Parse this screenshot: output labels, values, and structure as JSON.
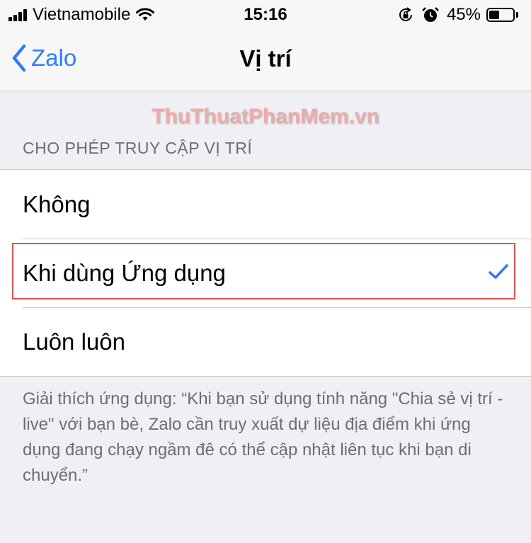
{
  "status_bar": {
    "carrier": "Vietnamobile",
    "time": "15:16",
    "battery_percent": "45%",
    "battery_level": 0.45,
    "icons": [
      "signal-icon",
      "wifi-icon",
      "rotation-lock-icon",
      "alarm-icon",
      "battery-icon"
    ]
  },
  "nav": {
    "back_label": "Zalo",
    "title": "Vị trí"
  },
  "watermark": "ThuThuatPhanMem.vn",
  "section": {
    "header": "CHO PHÉP TRUY CẬP VỊ TRÍ",
    "options": [
      {
        "label": "Không",
        "selected": false
      },
      {
        "label": "Khi dùng Ứng dụng",
        "selected": true
      },
      {
        "label": "Luôn luôn",
        "selected": false
      }
    ],
    "footer": "Giải thích ứng dụng: “Khi bạn sử dụng tính năng \"Chia sẻ vị trí - live\" với bạn bè, Zalo cần truy xuất dự liệu địa điểm khi ứng dụng đang chạy ngầm đê có thể cập nhật liên tục khi bạn di chuyển.”"
  },
  "colors": {
    "accent": "#2f7cf6",
    "highlight": "#e05050",
    "background": "#efeff4"
  }
}
